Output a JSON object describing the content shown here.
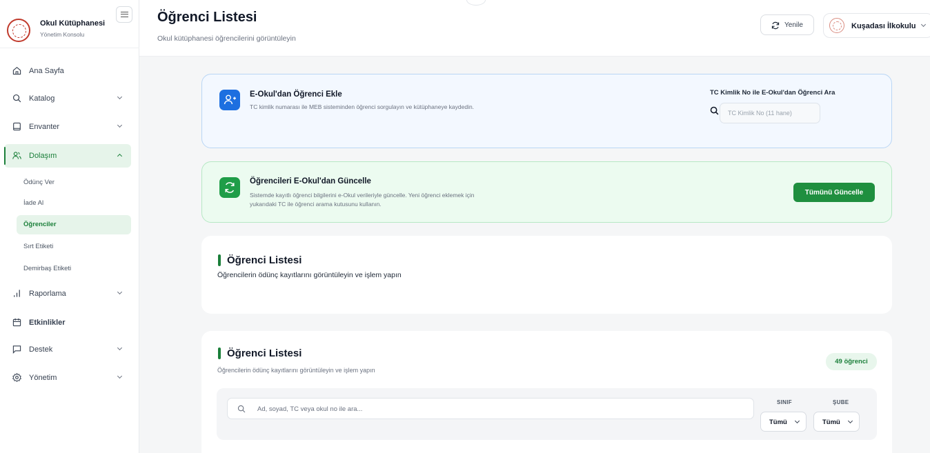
{
  "brand": {
    "title": "Okul Kütüphanesi",
    "subtitle": "Yönetim Konsolu"
  },
  "sidebar": {
    "items": [
      {
        "label": "Ana Sayfa",
        "icon": "home-icon"
      },
      {
        "label": "Katalog",
        "icon": "search-icon"
      },
      {
        "label": "Envanter",
        "icon": "box-icon"
      },
      {
        "label": "Dolaşım",
        "icon": "users-icon"
      },
      {
        "label": "Raporlama",
        "icon": "bar-chart-icon"
      },
      {
        "label": "Etkinlikler",
        "icon": "calendar-icon"
      },
      {
        "label": "Destek",
        "icon": "message-icon"
      },
      {
        "label": "Yönetim",
        "icon": "gear-icon"
      }
    ],
    "sub_items": [
      "Ödünç Ver",
      "İade Al",
      "Öğrenciler",
      "Sırt Etiketi",
      "Demirbaş Etiketi"
    ]
  },
  "header": {
    "title": "Öğrenci Listesi",
    "subtitle": "Okul kütüphanesi öğrencilerini görüntüleyin",
    "refresh_label": "Yenile",
    "school_name": "Kuşadası İlkokulu"
  },
  "eokul_add": {
    "title": "E-Okul'dan Öğrenci Ekle",
    "description": "TC kimlik numarası ile MEB sisteminden öğrenci sorgulayın ve kütüphaneye kaydedin.",
    "search_label": "TC Kimlik No ile E-Okul'dan Öğrenci Ara",
    "search_placeholder": "TC Kimlik No (11 hane)"
  },
  "eokul_update": {
    "title": "Öğrencileri E-Okul'dan Güncelle",
    "description_line1": "Sistemde kayıtlı öğrenci bilgilerini e-Okul verileriyle güncelle. Yeni öğrenci eklemek için",
    "description_line2": "yukarıdaki TC ile öğrenci arama kutusunu kullanın.",
    "button_label": "Tümünü Güncelle"
  },
  "list_section_1": {
    "title": "Öğrenci Listesi",
    "subtitle": "Öğrencilerin ödünç kayıtlarını görüntüleyin ve işlem yapın"
  },
  "list_section_2": {
    "title": "Öğrenci Listesi",
    "subtitle": "Öğrencilerin ödünç kayıtlarını görüntüleyin ve işlem yapın",
    "count_badge": "49 öğrenci",
    "search_placeholder": "Ad, soyad, TC veya okul no ile ara...",
    "class_label": "SINIF",
    "class_value": "Tümü",
    "branch_label": "ŞUBE",
    "branch_value": "Tümü"
  },
  "colors": {
    "accent": "#1b7f3a",
    "blue": "#1d6fe0",
    "green_button": "#1f8f3f"
  }
}
